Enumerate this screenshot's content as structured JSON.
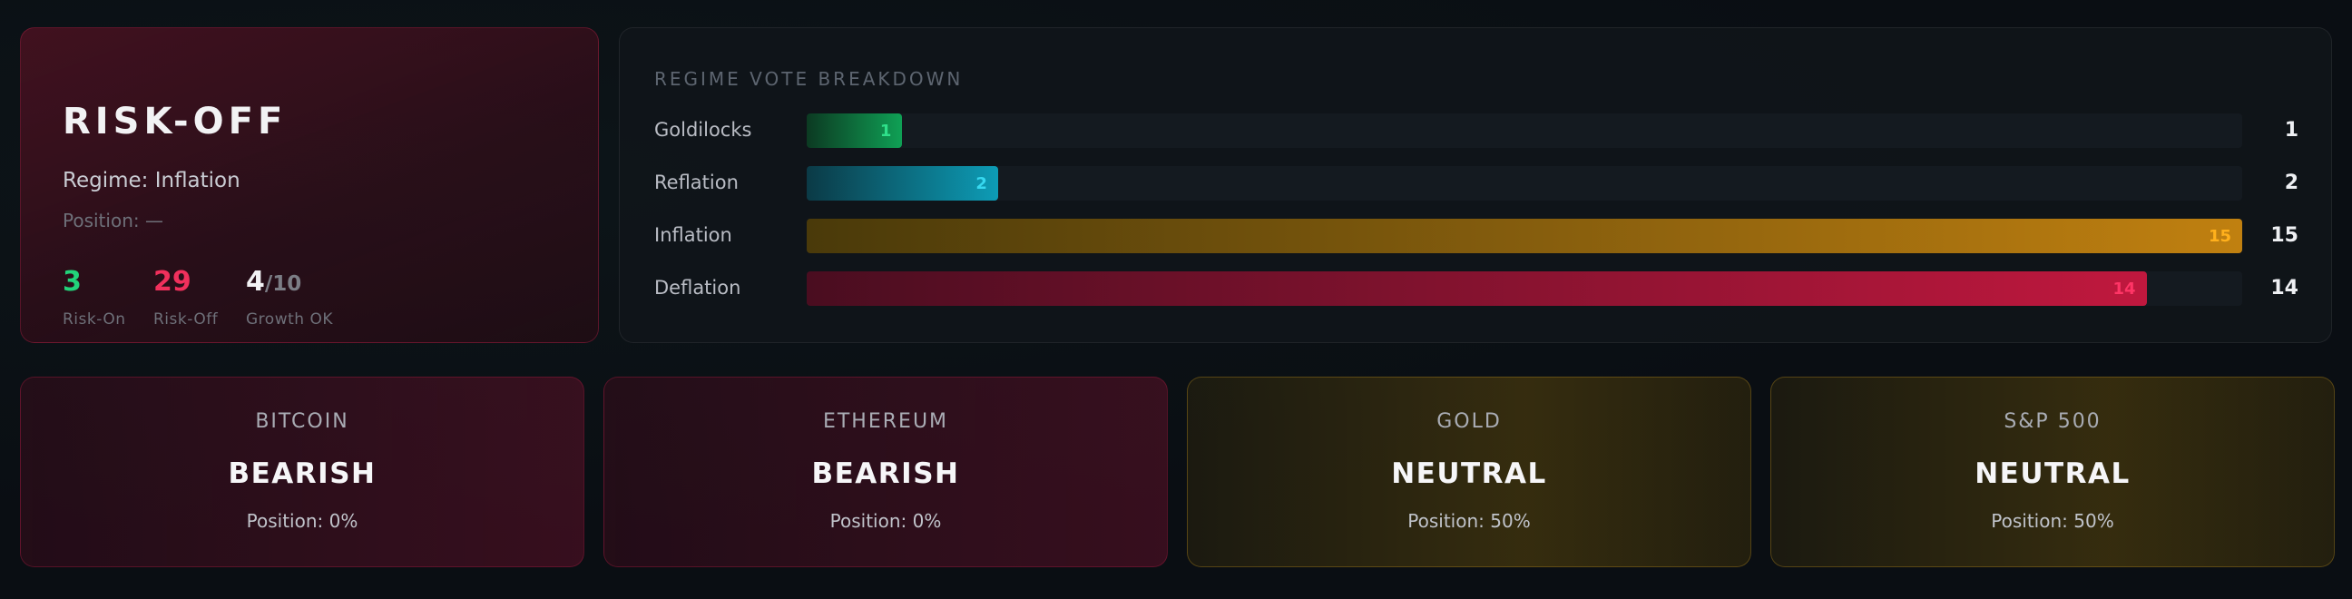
{
  "regime_card": {
    "title": "RISK-OFF",
    "regime_text": "Regime: Inflation",
    "position_text": "Position: —",
    "stats": [
      {
        "value": "3",
        "label": "Risk-On",
        "color": "#22d37a"
      },
      {
        "value": "29",
        "label": "Risk-Off",
        "color": "#f0305c"
      },
      {
        "value": "4",
        "denominator": "/10",
        "label": "Growth OK",
        "color": "#f2f2f4"
      }
    ]
  },
  "vote_breakdown": {
    "heading": "REGIME VOTE BREAKDOWN",
    "max": 15,
    "rows": [
      {
        "name": "Goldilocks",
        "votes": 1,
        "label": "1",
        "count": "1",
        "fill_from": "#0c3a22",
        "fill_to": "#0fa055",
        "text_color": "#2fe08a"
      },
      {
        "name": "Reflation",
        "votes": 2,
        "label": "2",
        "count": "2",
        "fill_from": "#0b3a46",
        "fill_to": "#0d9cb6",
        "text_color": "#37d8f0"
      },
      {
        "name": "Inflation",
        "votes": 15,
        "label": "15",
        "count": "15",
        "fill_from": "#4a3a0a",
        "fill_to": "#c08010",
        "text_color": "#ffb01c"
      },
      {
        "name": "Deflation",
        "votes": 14,
        "label": "14",
        "count": "14",
        "fill_from": "#4a0d20",
        "fill_to": "#c0183e",
        "text_color": "#ff3566"
      }
    ]
  },
  "assets": [
    {
      "name": "BITCOIN",
      "signal": "BEARISH",
      "position": "Position: 0%",
      "tone": "bear"
    },
    {
      "name": "ETHEREUM",
      "signal": "BEARISH",
      "position": "Position: 0%",
      "tone": "bear"
    },
    {
      "name": "GOLD",
      "signal": "NEUTRAL",
      "position": "Position: 50%",
      "tone": "neutral"
    },
    {
      "name": "S&P 500",
      "signal": "NEUTRAL",
      "position": "Position: 50%",
      "tone": "neutral"
    }
  ]
}
